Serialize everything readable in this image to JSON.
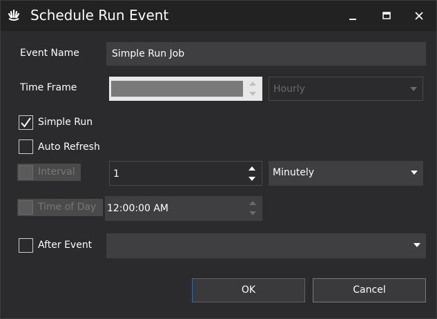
{
  "window": {
    "title": "Schedule Run Event",
    "icon": "app-logo-icon"
  },
  "form": {
    "event_name": {
      "label": "Event Name",
      "value": "Simple Run Job"
    },
    "time_frame": {
      "label": "Time Frame",
      "value": "",
      "option": "Hourly"
    },
    "simple_run": {
      "label": "Simple Run",
      "checked": true
    },
    "auto_refresh": {
      "label": "Auto Refresh",
      "checked": false
    },
    "interval": {
      "label": "Interval",
      "checked": false,
      "enabled": false,
      "value": "1",
      "unit": "Minutely"
    },
    "time_of_day": {
      "label": "Time of Day",
      "checked": false,
      "enabled": false,
      "value": "12:00:00 AM"
    },
    "after_event": {
      "label": "After Event",
      "checked": false,
      "value": ""
    }
  },
  "buttons": {
    "ok": "OK",
    "cancel": "Cancel"
  },
  "colors": {
    "background": "#2b2b2d",
    "titlebar": "#222222",
    "field": "#3f3f41",
    "accent": "#2e6db4"
  }
}
